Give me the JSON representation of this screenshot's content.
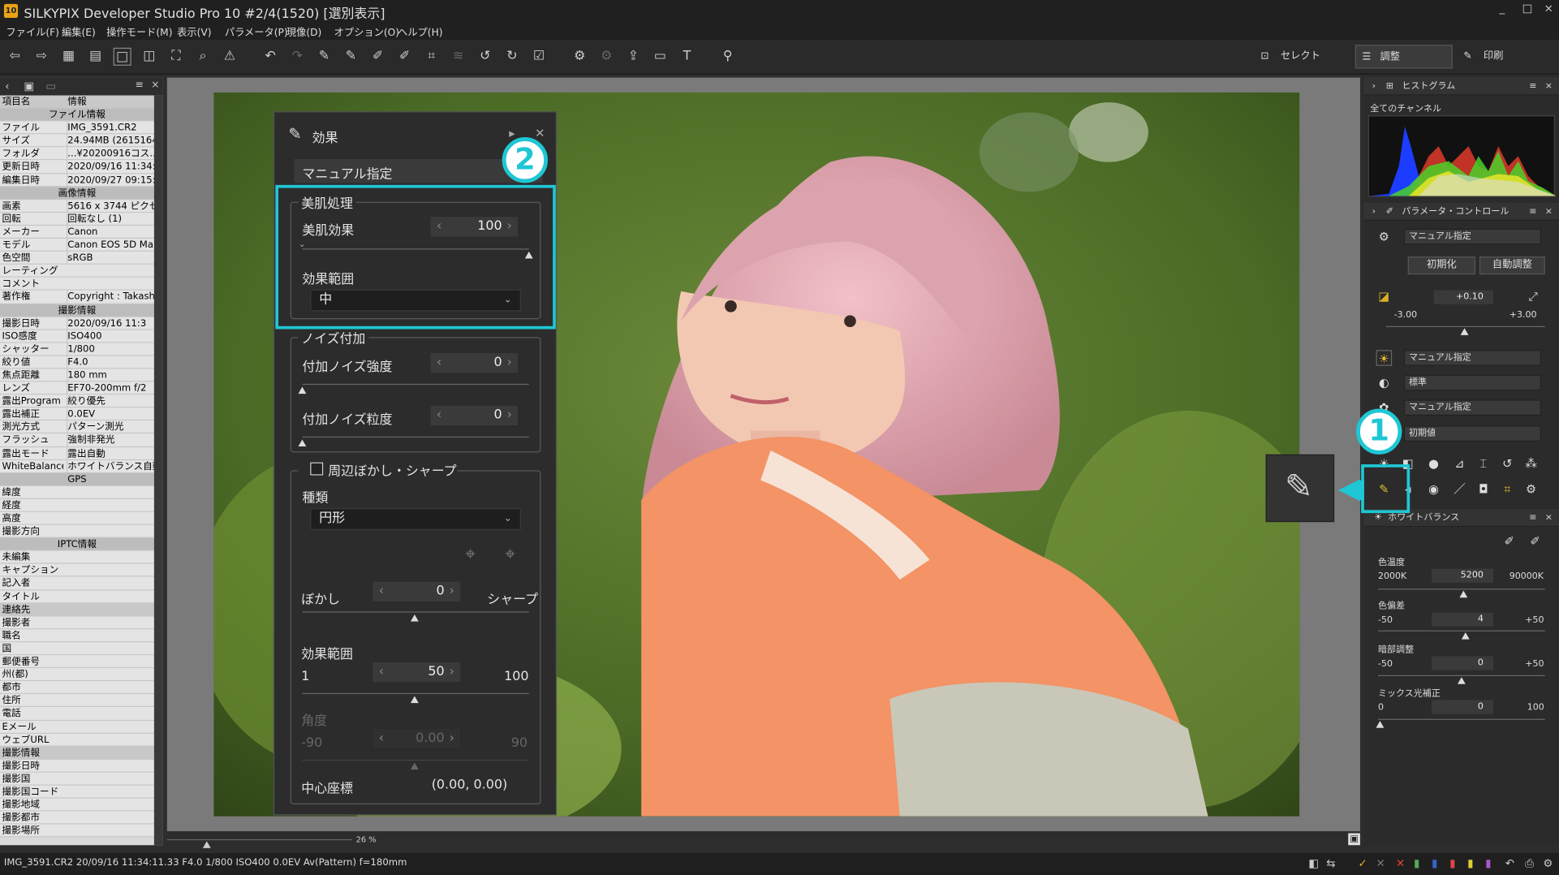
{
  "title": "SILKYPIX Developer Studio Pro 10   #2/4(1520) [選別表示]",
  "app_icon": "10",
  "window_controls": [
    "_",
    "□",
    "×"
  ],
  "menu": [
    "ファイル(F)",
    "編集(E)",
    "操作モード(M)",
    "表示(V)",
    "パラメータ(P)",
    "現像(D)",
    "オプション(O)",
    "ヘルプ(H)"
  ],
  "modes": {
    "select": "セレクト",
    "adjust": "調整",
    "print": "印刷"
  },
  "left": {
    "col_key": "項目名",
    "col_val": "情報",
    "rows": [
      [
        "sec",
        "ファイル情報",
        ""
      ],
      [
        "r",
        "ファイル",
        "IMG_3591.CR2"
      ],
      [
        "r",
        "サイズ",
        "24.94MB (2615164"
      ],
      [
        "r",
        "フォルダ",
        "...¥20200916コス..."
      ],
      [
        "r",
        "更新日時",
        "2020/09/16 11:34:"
      ],
      [
        "r",
        "編集日時",
        "2020/09/27 09:15:"
      ],
      [
        "sec",
        "画像情報",
        ""
      ],
      [
        "r",
        "画素",
        "5616 x 3744 ピクセ"
      ],
      [
        "r",
        "回転",
        "回転なし (1)"
      ],
      [
        "r",
        "メーカー",
        "Canon"
      ],
      [
        "r",
        "モデル",
        "Canon EOS 5D Mar"
      ],
      [
        "r",
        "色空間",
        "sRGB"
      ],
      [
        "r",
        "レーティング",
        ""
      ],
      [
        "r",
        "コメント",
        ""
      ],
      [
        "r",
        "著作権",
        "Copyright : Takash"
      ],
      [
        "sec",
        "撮影情報",
        ""
      ],
      [
        "r",
        "撮影日時",
        "2020/09/16 11:3"
      ],
      [
        "r",
        "ISO感度",
        "ISO400"
      ],
      [
        "r",
        "シャッター",
        "1/800"
      ],
      [
        "r",
        "絞り値",
        "F4.0"
      ],
      [
        "r",
        "焦点距離",
        "180 mm"
      ],
      [
        "r",
        "レンズ",
        "EF70-200mm f/2"
      ],
      [
        "r",
        "露出Program",
        "絞り優先"
      ],
      [
        "r",
        "露出補正",
        "0.0EV"
      ],
      [
        "r",
        "測光方式",
        "パターン測光"
      ],
      [
        "r",
        "フラッシュ",
        "強制非発光"
      ],
      [
        "r",
        "露出モード",
        "露出自動"
      ],
      [
        "r",
        "WhiteBalance",
        "ホワイトバランス自動"
      ],
      [
        "sec",
        "GPS",
        ""
      ],
      [
        "r",
        "緯度",
        ""
      ],
      [
        "r",
        "経度",
        ""
      ],
      [
        "r",
        "高度",
        ""
      ],
      [
        "r",
        "撮影方向",
        ""
      ],
      [
        "sec",
        "IPTC情報",
        ""
      ],
      [
        "r",
        "未編集",
        ""
      ],
      [
        "r",
        "キャプション",
        ""
      ],
      [
        "r",
        "記入者",
        ""
      ],
      [
        "r",
        "タイトル",
        ""
      ],
      [
        "sec2",
        "連絡先",
        ""
      ],
      [
        "r",
        "撮影者",
        ""
      ],
      [
        "r",
        "職名",
        ""
      ],
      [
        "r",
        "国",
        ""
      ],
      [
        "r",
        "郵便番号",
        ""
      ],
      [
        "r",
        "州(都)",
        ""
      ],
      [
        "r",
        "都市",
        ""
      ],
      [
        "r",
        "住所",
        ""
      ],
      [
        "r",
        "電話",
        ""
      ],
      [
        "r",
        "Eメール",
        ""
      ],
      [
        "r",
        "ウェブURL",
        ""
      ],
      [
        "sec2",
        "撮影情報",
        ""
      ],
      [
        "r",
        "撮影日時",
        ""
      ],
      [
        "r",
        "撮影国",
        ""
      ],
      [
        "r",
        "撮影国コード",
        ""
      ],
      [
        "r",
        "撮影地域",
        ""
      ],
      [
        "r",
        "撮影都市",
        ""
      ],
      [
        "r",
        "撮影場所",
        ""
      ]
    ]
  },
  "zoom": "26 %",
  "status": "IMG_3591.CR2 20/09/16 11:34:11.33 F4.0 1/800 ISO400  0.0EV Av(Pattern) f=180mm",
  "effect": {
    "title": "効果",
    "preset": "マニュアル指定",
    "skin_group": "美肌処理",
    "skin_effect_label": "美肌効果",
    "skin_effect_value": "100",
    "range_label": "効果範囲",
    "range_value": "中",
    "noise_group": "ノイズ付加",
    "noise_strength_label": "付加ノイズ強度",
    "noise_strength_value": "0",
    "noise_grain_label": "付加ノイズ粒度",
    "noise_grain_value": "0",
    "vignette_group": "周辺ぼかし・シャープ",
    "type_label": "種類",
    "type_value": "円形",
    "blur_label": "ぼかし",
    "blur_value": "0",
    "sharp_label": "シャープ",
    "erange_label": "効果範囲",
    "erange_value": "50",
    "erange_min": "1",
    "erange_max": "100",
    "angle_label": "角度",
    "angle_value": "0.00",
    "angle_min": "-90",
    "angle_max": "90",
    "center_label": "中心座標",
    "center_value": "(0.00, 0.00)"
  },
  "right": {
    "histogram": "ヒストグラム",
    "channel": "全てのチャンネル",
    "param_ctrl": "パラメータ・コントロール",
    "preset": "マニュアル指定",
    "init": "初期化",
    "auto": "自動調整",
    "exposure": "+0.10",
    "exp_min": "-3.00",
    "exp_max": "+3.00",
    "wb_preset": "マニュアル指定",
    "tone": "標準",
    "color_preset": "マニュアル指定",
    "default": "初期値",
    "wb": "ホワイトバランス",
    "temp_label": "色温度",
    "temp_min": "2000K",
    "temp_value": "5200",
    "temp_max": "90000K",
    "tint_label": "色偏差",
    "tint_min": "-50",
    "tint_value": "4",
    "tint_max": "+50",
    "dark_label": "暗部調整",
    "dark_min": "-50",
    "dark_value": "0",
    "dark_max": "+50",
    "mix_label": "ミックス光補正",
    "mix_min": "0",
    "mix_value": "0",
    "mix_max": "100"
  },
  "callouts": {
    "one": "1",
    "two": "2"
  },
  "colors": {
    "accent": "#1fc7d4"
  }
}
